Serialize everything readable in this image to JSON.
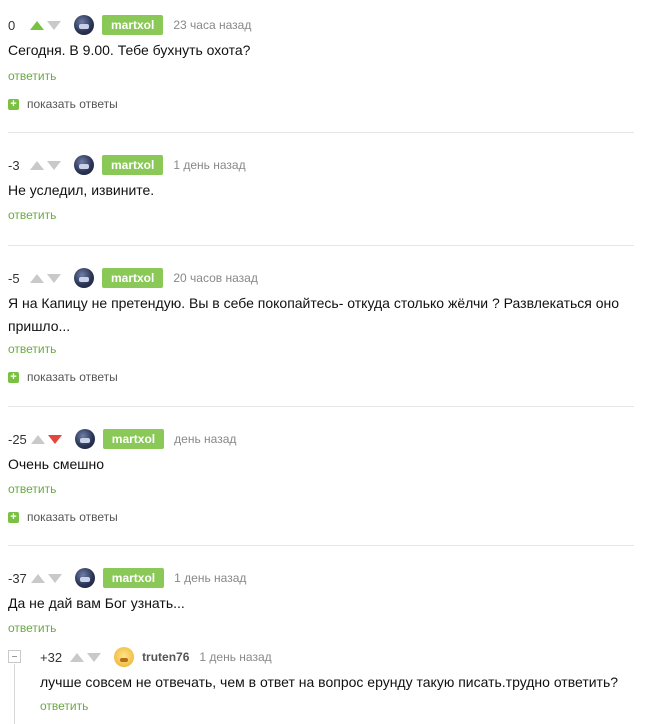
{
  "comments": [
    {
      "rating": "0",
      "user": "martxol",
      "time": "23 часа назад",
      "text": "Сегодня. В 9.00. Тебе бухнуть охота?",
      "reply": "ответить",
      "show_replies": "показать ответы",
      "vote": "up"
    },
    {
      "rating": "-3",
      "user": "martxol",
      "time": "1 день назад",
      "text": "Не уследил, извините.",
      "reply": "ответить",
      "vote": "none"
    },
    {
      "rating": "-5",
      "user": "martxol",
      "time": "20 часов назад",
      "text_line1": "Я на Капицу не претендую. Вы в себе покопайтесь- откуда столько жёлчи ? Развлекаться оно",
      "text_line2": "пришло...",
      "reply": "ответить",
      "show_replies": "показать ответы",
      "vote": "none"
    },
    {
      "rating": "-25",
      "user": "martxol",
      "time": "день назад",
      "text": "Очень смешно",
      "reply": "ответить",
      "show_replies": "показать ответы",
      "vote": "down"
    },
    {
      "rating": "-37",
      "user": "martxol",
      "time": "1 день назад",
      "text": "Да не дай вам Бог узнать...",
      "reply": "ответить",
      "vote": "none"
    }
  ],
  "nested_reply": {
    "rating": "+32",
    "user": "truten76",
    "time": "1 день назад",
    "text": "лучше совсем не отвечать, чем в ответ на вопрос ерунду такую писать.трудно ответить?",
    "reply": "ответить"
  },
  "colors": {
    "accent_green": "#7ac142",
    "badge_green": "#8ac858",
    "downvote_red": "#e5463b"
  }
}
